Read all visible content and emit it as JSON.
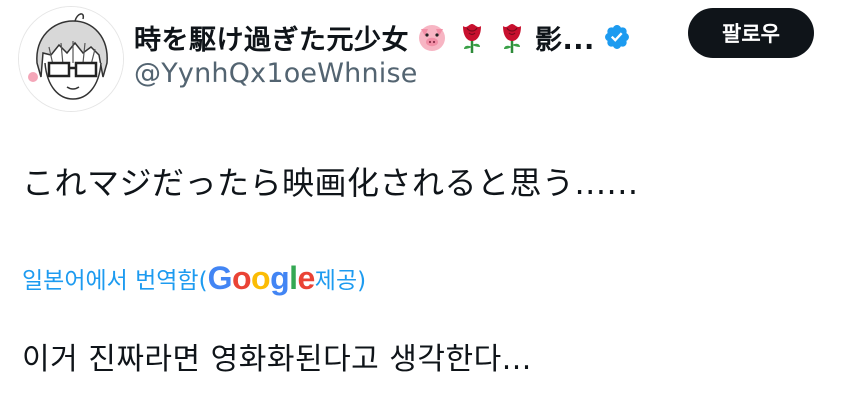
{
  "user": {
    "display_name": "時を駆け過ぎた元少女",
    "name_suffix": "影...",
    "emojis": [
      "pig-face-icon",
      "rose-icon",
      "rose-icon"
    ],
    "handle": "@YynhQx1oeWhnise",
    "verified": true
  },
  "follow_button": {
    "label": "팔로우"
  },
  "tweet": {
    "text": "これマジだったら映画化されると思う......"
  },
  "translation": {
    "label_prefix": "일본어에서 번역함(",
    "provider_letters": [
      "G",
      "o",
      "o",
      "g",
      "l",
      "e"
    ],
    "label_suffix": " 제공)",
    "text": "이거 진짜라면 영화화된다고 생각한다..."
  },
  "colors": {
    "link": "#1d9bf0",
    "handle": "#536471",
    "button_bg": "#0f1419",
    "verified": "#1d9bf0"
  }
}
